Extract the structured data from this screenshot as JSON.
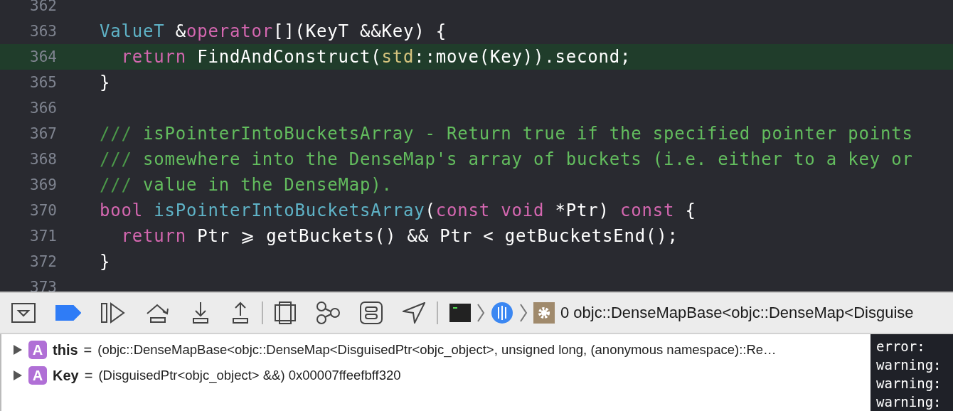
{
  "editor": {
    "lines": [
      {
        "number": "362",
        "highlighted": false
      },
      {
        "number": "363",
        "highlighted": false,
        "tokens": [
          {
            "text": "ValueT",
            "kind": "type"
          },
          {
            "text": " &",
            "kind": "plain"
          },
          {
            "text": "operator",
            "kind": "keyword"
          },
          {
            "text": "[](KeyT &&Key) {",
            "kind": "plain"
          }
        ]
      },
      {
        "number": "364",
        "highlighted": true,
        "tokens": [
          {
            "text": "  return",
            "kind": "keyword"
          },
          {
            "text": " FindAndConstruct(",
            "kind": "plain"
          },
          {
            "text": "std",
            "kind": "namespace"
          },
          {
            "text": "::move(Key)).second;",
            "kind": "plain"
          }
        ]
      },
      {
        "number": "365",
        "highlighted": false,
        "tokens": [
          {
            "text": "}",
            "kind": "plain"
          }
        ]
      },
      {
        "number": "366",
        "highlighted": false
      },
      {
        "number": "367",
        "highlighted": false,
        "tokens": [
          {
            "text": "///",
            "kind": "comment-mark"
          },
          {
            "text": " isPointerIntoBucketsArray - Return true if the specified pointer points",
            "kind": "comment"
          }
        ]
      },
      {
        "number": "368",
        "highlighted": false,
        "tokens": [
          {
            "text": "///",
            "kind": "comment-mark"
          },
          {
            "text": " somewhere into the DenseMap's array of buckets (i.e. either to a key or",
            "kind": "comment"
          }
        ]
      },
      {
        "number": "369",
        "highlighted": false,
        "tokens": [
          {
            "text": "///",
            "kind": "comment-mark"
          },
          {
            "text": " value in the DenseMap).",
            "kind": "comment"
          }
        ]
      },
      {
        "number": "370",
        "highlighted": false,
        "tokens": [
          {
            "text": "bool",
            "kind": "keyword"
          },
          {
            "text": " isPointerIntoBucketsArray",
            "kind": "type"
          },
          {
            "text": "(",
            "kind": "plain"
          },
          {
            "text": "const void",
            "kind": "keyword"
          },
          {
            "text": " *Ptr) ",
            "kind": "plain"
          },
          {
            "text": "const",
            "kind": "keyword"
          },
          {
            "text": " {",
            "kind": "plain"
          }
        ]
      },
      {
        "number": "371",
        "highlighted": false,
        "tokens": [
          {
            "text": "  return",
            "kind": "keyword"
          },
          {
            "text": " Ptr ⩾ getBuckets() && Ptr < getBucketsEnd();",
            "kind": "plain"
          }
        ]
      },
      {
        "number": "372",
        "highlighted": false,
        "tokens": [
          {
            "text": "}",
            "kind": "plain"
          }
        ]
      },
      {
        "number": "373",
        "highlighted": false
      }
    ]
  },
  "debug_bar": {
    "breakpoints_active": true,
    "frame": "0 objc::DenseMapBase<objc::DenseMap<Disguise"
  },
  "variables": [
    {
      "badge": "A",
      "name": "this",
      "separator": "=",
      "value": "(objc::DenseMapBase<objc::DenseMap<DisguisedPtr<objc_object>, unsigned long, (anonymous namespace)::Re…",
      "expanded": false
    },
    {
      "badge": "A",
      "name": "Key",
      "separator": "=",
      "value": "(DisguisedPtr<objc_object> &&) 0x00007ffeefbff320",
      "expanded": false
    }
  ],
  "console": {
    "lines": [
      "error:",
      "warning:",
      "warning:",
      "warning:"
    ]
  }
}
